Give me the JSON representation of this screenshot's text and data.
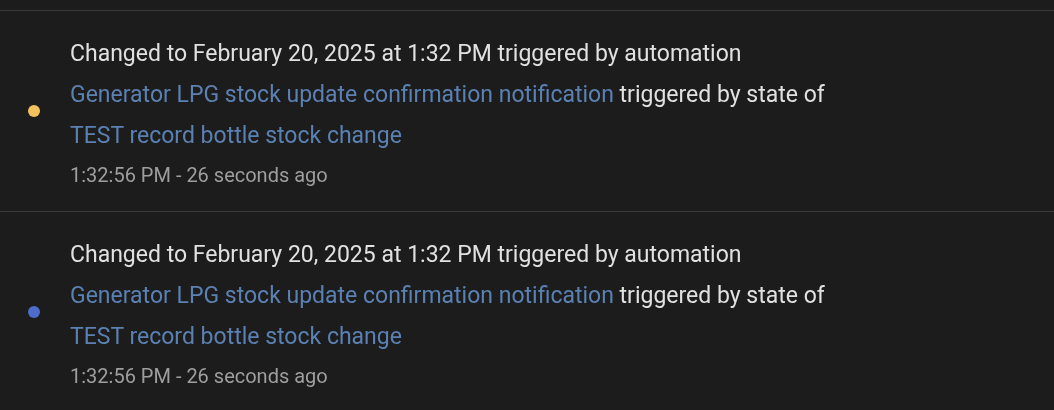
{
  "entries": [
    {
      "color": "#f2c25c",
      "message": [
        {
          "kind": "text",
          "text": "Changed to February 20, 2025 at 1:32 PM triggered by automation "
        },
        {
          "kind": "link",
          "text": "Generator LPG stock update confirmation notification"
        },
        {
          "kind": "text",
          "text": " triggered by state of "
        },
        {
          "kind": "link",
          "text": "TEST record bottle stock change"
        }
      ],
      "time": "1:32:56 PM - 26 seconds ago"
    },
    {
      "color": "#4f6bcc",
      "message": [
        {
          "kind": "text",
          "text": "Changed to February 20, 2025 at 1:32 PM triggered by automation "
        },
        {
          "kind": "link",
          "text": "Generator LPG stock update confirmation notification"
        },
        {
          "kind": "text",
          "text": " triggered by state of "
        },
        {
          "kind": "link",
          "text": "TEST record bottle stock change"
        }
      ],
      "time": "1:32:56 PM - 26 seconds ago"
    }
  ]
}
